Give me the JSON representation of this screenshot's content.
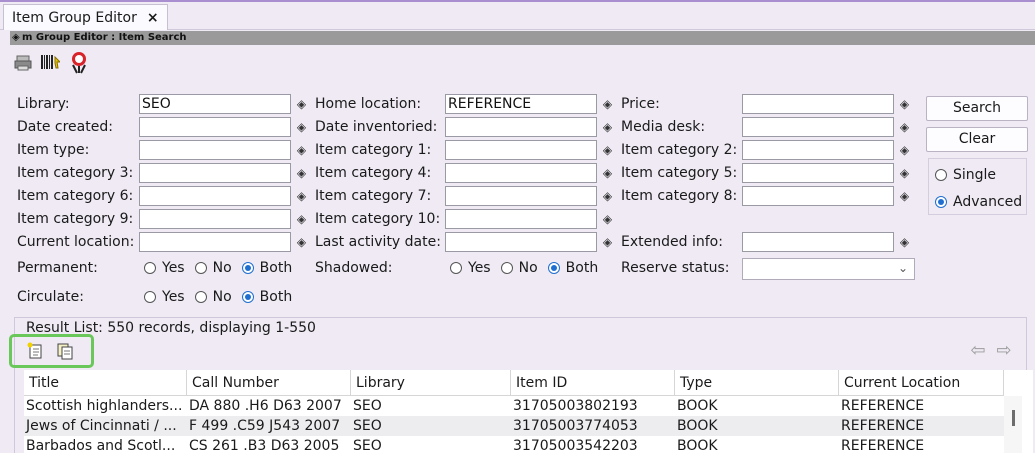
{
  "window": {
    "tab_title": "Item Group Editor",
    "close_glyph": "×",
    "subtitle": "m Group Editor : Item Search"
  },
  "toolbar": {
    "icons": [
      "print-icon",
      "barcode-icon",
      "helpdesk-icon"
    ]
  },
  "form": {
    "library": {
      "label": "Library:",
      "value": "SEO"
    },
    "home_location": {
      "label": "Home location:",
      "value": "REFERENCE"
    },
    "price": {
      "label": "Price:",
      "value": ""
    },
    "date_created": {
      "label": "Date created:",
      "value": ""
    },
    "date_inventoried": {
      "label": "Date inventoried:",
      "value": ""
    },
    "media_desk": {
      "label": "Media desk:",
      "value": ""
    },
    "item_type": {
      "label": "Item type:",
      "value": ""
    },
    "item_category_1": {
      "label": "Item category 1:",
      "value": ""
    },
    "item_category_2": {
      "label": "Item category 2:",
      "value": ""
    },
    "item_category_3": {
      "label": "Item category 3:",
      "value": ""
    },
    "item_category_4": {
      "label": "Item category 4:",
      "value": ""
    },
    "item_category_5": {
      "label": "Item category 5:",
      "value": ""
    },
    "item_category_6": {
      "label": "Item category 6:",
      "value": ""
    },
    "item_category_7": {
      "label": "Item category 7:",
      "value": ""
    },
    "item_category_8": {
      "label": "Item category 8:",
      "value": ""
    },
    "item_category_9": {
      "label": "Item category 9:",
      "value": ""
    },
    "item_category_10": {
      "label": "Item category 10:",
      "value": ""
    },
    "current_location": {
      "label": "Current location:",
      "value": ""
    },
    "last_activity_date": {
      "label": "Last activity date:",
      "value": ""
    },
    "extended_info": {
      "label": "Extended info:",
      "value": ""
    },
    "permanent": {
      "label": "Permanent:",
      "options": [
        "Yes",
        "No",
        "Both"
      ],
      "selected": "Both"
    },
    "shadowed": {
      "label": "Shadowed:",
      "options": [
        "Yes",
        "No",
        "Both"
      ],
      "selected": "Both"
    },
    "circulate": {
      "label": "Circulate:",
      "options": [
        "Yes",
        "No",
        "Both"
      ],
      "selected": "Both"
    },
    "reserve_status": {
      "label": "Reserve status:",
      "value": ""
    }
  },
  "buttons": {
    "search": "Search",
    "clear": "Clear"
  },
  "mode": {
    "single": "Single",
    "advanced": "Advanced",
    "selected": "Advanced"
  },
  "results": {
    "label": "Result List: 550 records, displaying 1-550",
    "columns": [
      "Title",
      "Call Number",
      "Library",
      "Item ID",
      "Type",
      "Current Location"
    ],
    "rows": [
      [
        "Scottish highlanders...",
        "DA 880 .H6 D63 2007",
        "SEO",
        "31705003802193",
        "BOOK",
        "REFERENCE"
      ],
      [
        "Jews of Cincinnati / ...",
        "F 499 .C59 J543 2007",
        "SEO",
        "31705003774053",
        "BOOK",
        "REFERENCE"
      ],
      [
        "Barbados and Scotl...",
        "CS 261 .B3 D63 2005",
        "SEO",
        "31705003542203",
        "BOOK",
        "REFERENCE"
      ]
    ]
  },
  "colors": {
    "accent": "#1f6fd1",
    "highlight": "#6ac85a",
    "background": "#efeaf4"
  }
}
